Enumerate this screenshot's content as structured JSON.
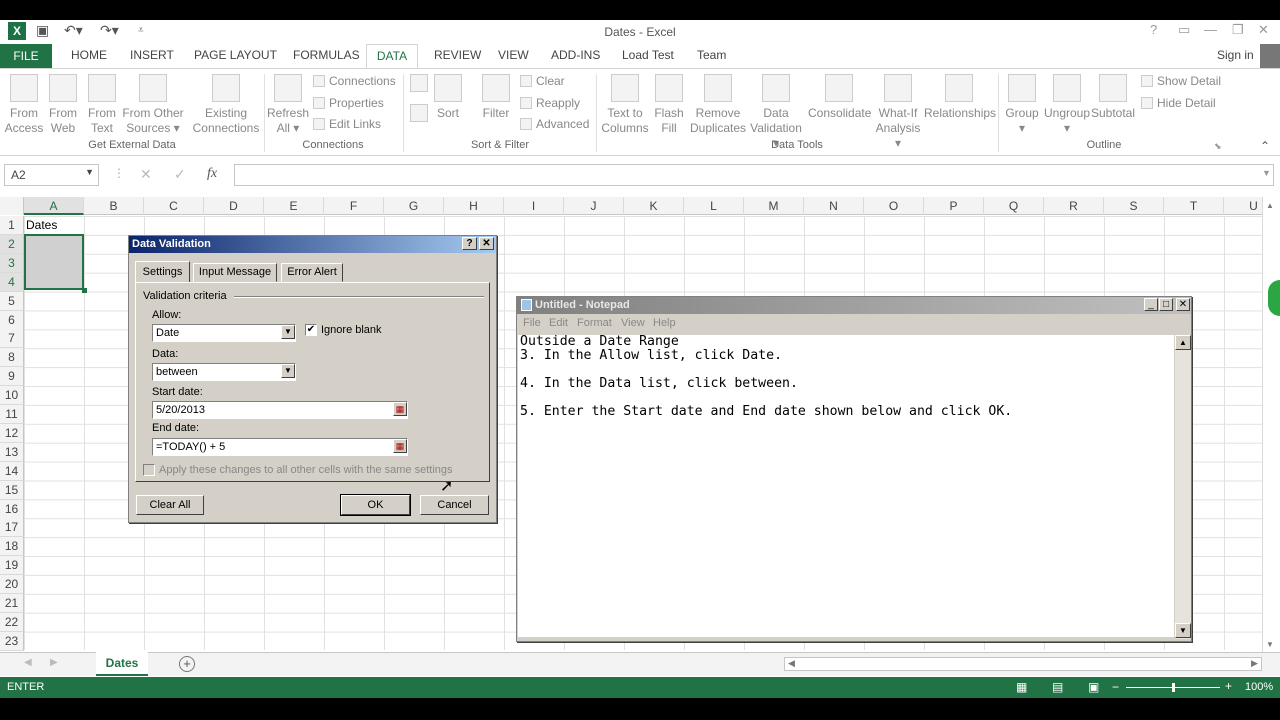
{
  "window": {
    "title": "Dates - Excel",
    "sign_in": "Sign in"
  },
  "ribbon_tabs": [
    "FILE",
    "HOME",
    "INSERT",
    "PAGE LAYOUT",
    "FORMULAS",
    "DATA",
    "REVIEW",
    "VIEW",
    "ADD-INS",
    "Load Test",
    "Team"
  ],
  "ribbon": {
    "from_access": [
      "From",
      "Access"
    ],
    "from_web": [
      "From",
      "Web"
    ],
    "from_text": [
      "From",
      "Text"
    ],
    "from_other": [
      "From Other",
      "Sources ▾"
    ],
    "existing": [
      "Existing",
      "Connections"
    ],
    "refresh": [
      "Refresh",
      "All ▾"
    ],
    "connections": "Connections",
    "properties": "Properties",
    "edit_links": "Edit Links",
    "sort": "Sort",
    "filter": "Filter",
    "clear": "Clear",
    "reapply": "Reapply",
    "advanced": "Advanced",
    "text_to_columns": [
      "Text to",
      "Columns"
    ],
    "flash_fill": [
      "Flash",
      "Fill"
    ],
    "remove_dup": [
      "Remove",
      "Duplicates"
    ],
    "data_validation": [
      "Data",
      "Validation ▾"
    ],
    "consolidate": "Consolidate",
    "what_if": [
      "What-If",
      "Analysis ▾"
    ],
    "relationships": "Relationships",
    "group": "Group",
    "ungroup": "Ungroup",
    "subtotal": "Subtotal",
    "show_detail": "Show Detail",
    "hide_detail": "Hide Detail",
    "groups": [
      "Get External Data",
      "Connections",
      "Sort & Filter",
      "Data Tools",
      "Outline"
    ]
  },
  "formula_bar": {
    "name_box": "A2",
    "fx": "fx",
    "value": ""
  },
  "columns": [
    "A",
    "B",
    "C",
    "D",
    "E",
    "F",
    "G",
    "H",
    "I",
    "J",
    "K",
    "L",
    "M",
    "N",
    "O",
    "P",
    "Q",
    "R",
    "S",
    "T",
    "U"
  ],
  "rows": [
    "1",
    "2",
    "3",
    "4",
    "5",
    "6",
    "7",
    "8",
    "9",
    "10",
    "11",
    "12",
    "13",
    "14",
    "15",
    "16",
    "17",
    "18",
    "19",
    "20",
    "21",
    "22",
    "23"
  ],
  "cells": {
    "A1": "Dates"
  },
  "sheet_tab": "Dates",
  "status": {
    "mode": "ENTER",
    "zoom": "100%"
  },
  "dialog": {
    "title": "Data Validation",
    "tabs": [
      "Settings",
      "Input Message",
      "Error Alert"
    ],
    "criteria_label": "Validation criteria",
    "allow_label": "Allow:",
    "allow_value": "Date",
    "ignore_blank": "Ignore blank",
    "data_label": "Data:",
    "data_value": "between",
    "start_label": "Start date:",
    "start_value": "5/20/2013",
    "end_label": "End date:",
    "end_value": "=TODAY() + 5",
    "apply_all": "Apply these changes to all other cells with the same settings",
    "clear_all": "Clear All",
    "ok": "OK",
    "cancel": "Cancel"
  },
  "notepad": {
    "title": "Untitled - Notepad",
    "menu": [
      "File",
      "Edit",
      "Format",
      "View",
      "Help"
    ],
    "text": "Outside a Date Range\n3. In the Allow list, click Date.\n\n4. In the Data list, click between.\n\n5. Enter the Start date and End date shown below and click OK."
  }
}
